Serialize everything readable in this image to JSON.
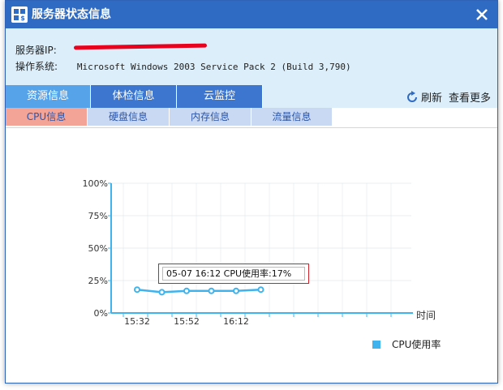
{
  "dialog": {
    "title": "服务器状态信息",
    "close_symbol": "✕"
  },
  "info": {
    "ip_label": "服务器IP:",
    "os_label": "操作系统:",
    "os_value": "Microsoft Windows 2003 Service Pack 2 (Build 3,790)"
  },
  "tabs": [
    {
      "label": "资源信息",
      "active": true
    },
    {
      "label": "体检信息",
      "active": false
    },
    {
      "label": "云监控",
      "active": false
    }
  ],
  "actions": {
    "refresh_label": "刷新",
    "more_label": "查看更多"
  },
  "subtabs": [
    {
      "label": "CPU信息",
      "active": true
    },
    {
      "label": "硬盘信息",
      "active": false
    },
    {
      "label": "内存信息",
      "active": false
    },
    {
      "label": "流量信息",
      "active": false
    }
  ],
  "tooltip": {
    "text": "05-07 16:12 CPU使用率:17%"
  },
  "colors": {
    "title_bar": "#2f6bc3",
    "tab_active": "#56a3ea",
    "subtab_active": "#f3a497",
    "series": "#3eb3ee",
    "axis": "#3eb3ee"
  },
  "chart_data": {
    "type": "line",
    "ylim": [
      0,
      100
    ],
    "y_ticks": [
      "0%",
      "25%",
      "50%",
      "75%",
      "100%"
    ],
    "x_tick_labels": [
      "15:32",
      "15:52",
      "16:12"
    ],
    "xlabel": "时间",
    "grid": true,
    "legend_position": "bottom-right",
    "series": [
      {
        "name": "CPU使用率",
        "x": [
          "15:32",
          "15:42",
          "15:52",
          "16:02",
          "16:12",
          "16:22"
        ],
        "values": [
          18,
          16,
          17,
          17,
          17,
          18
        ]
      }
    ]
  }
}
